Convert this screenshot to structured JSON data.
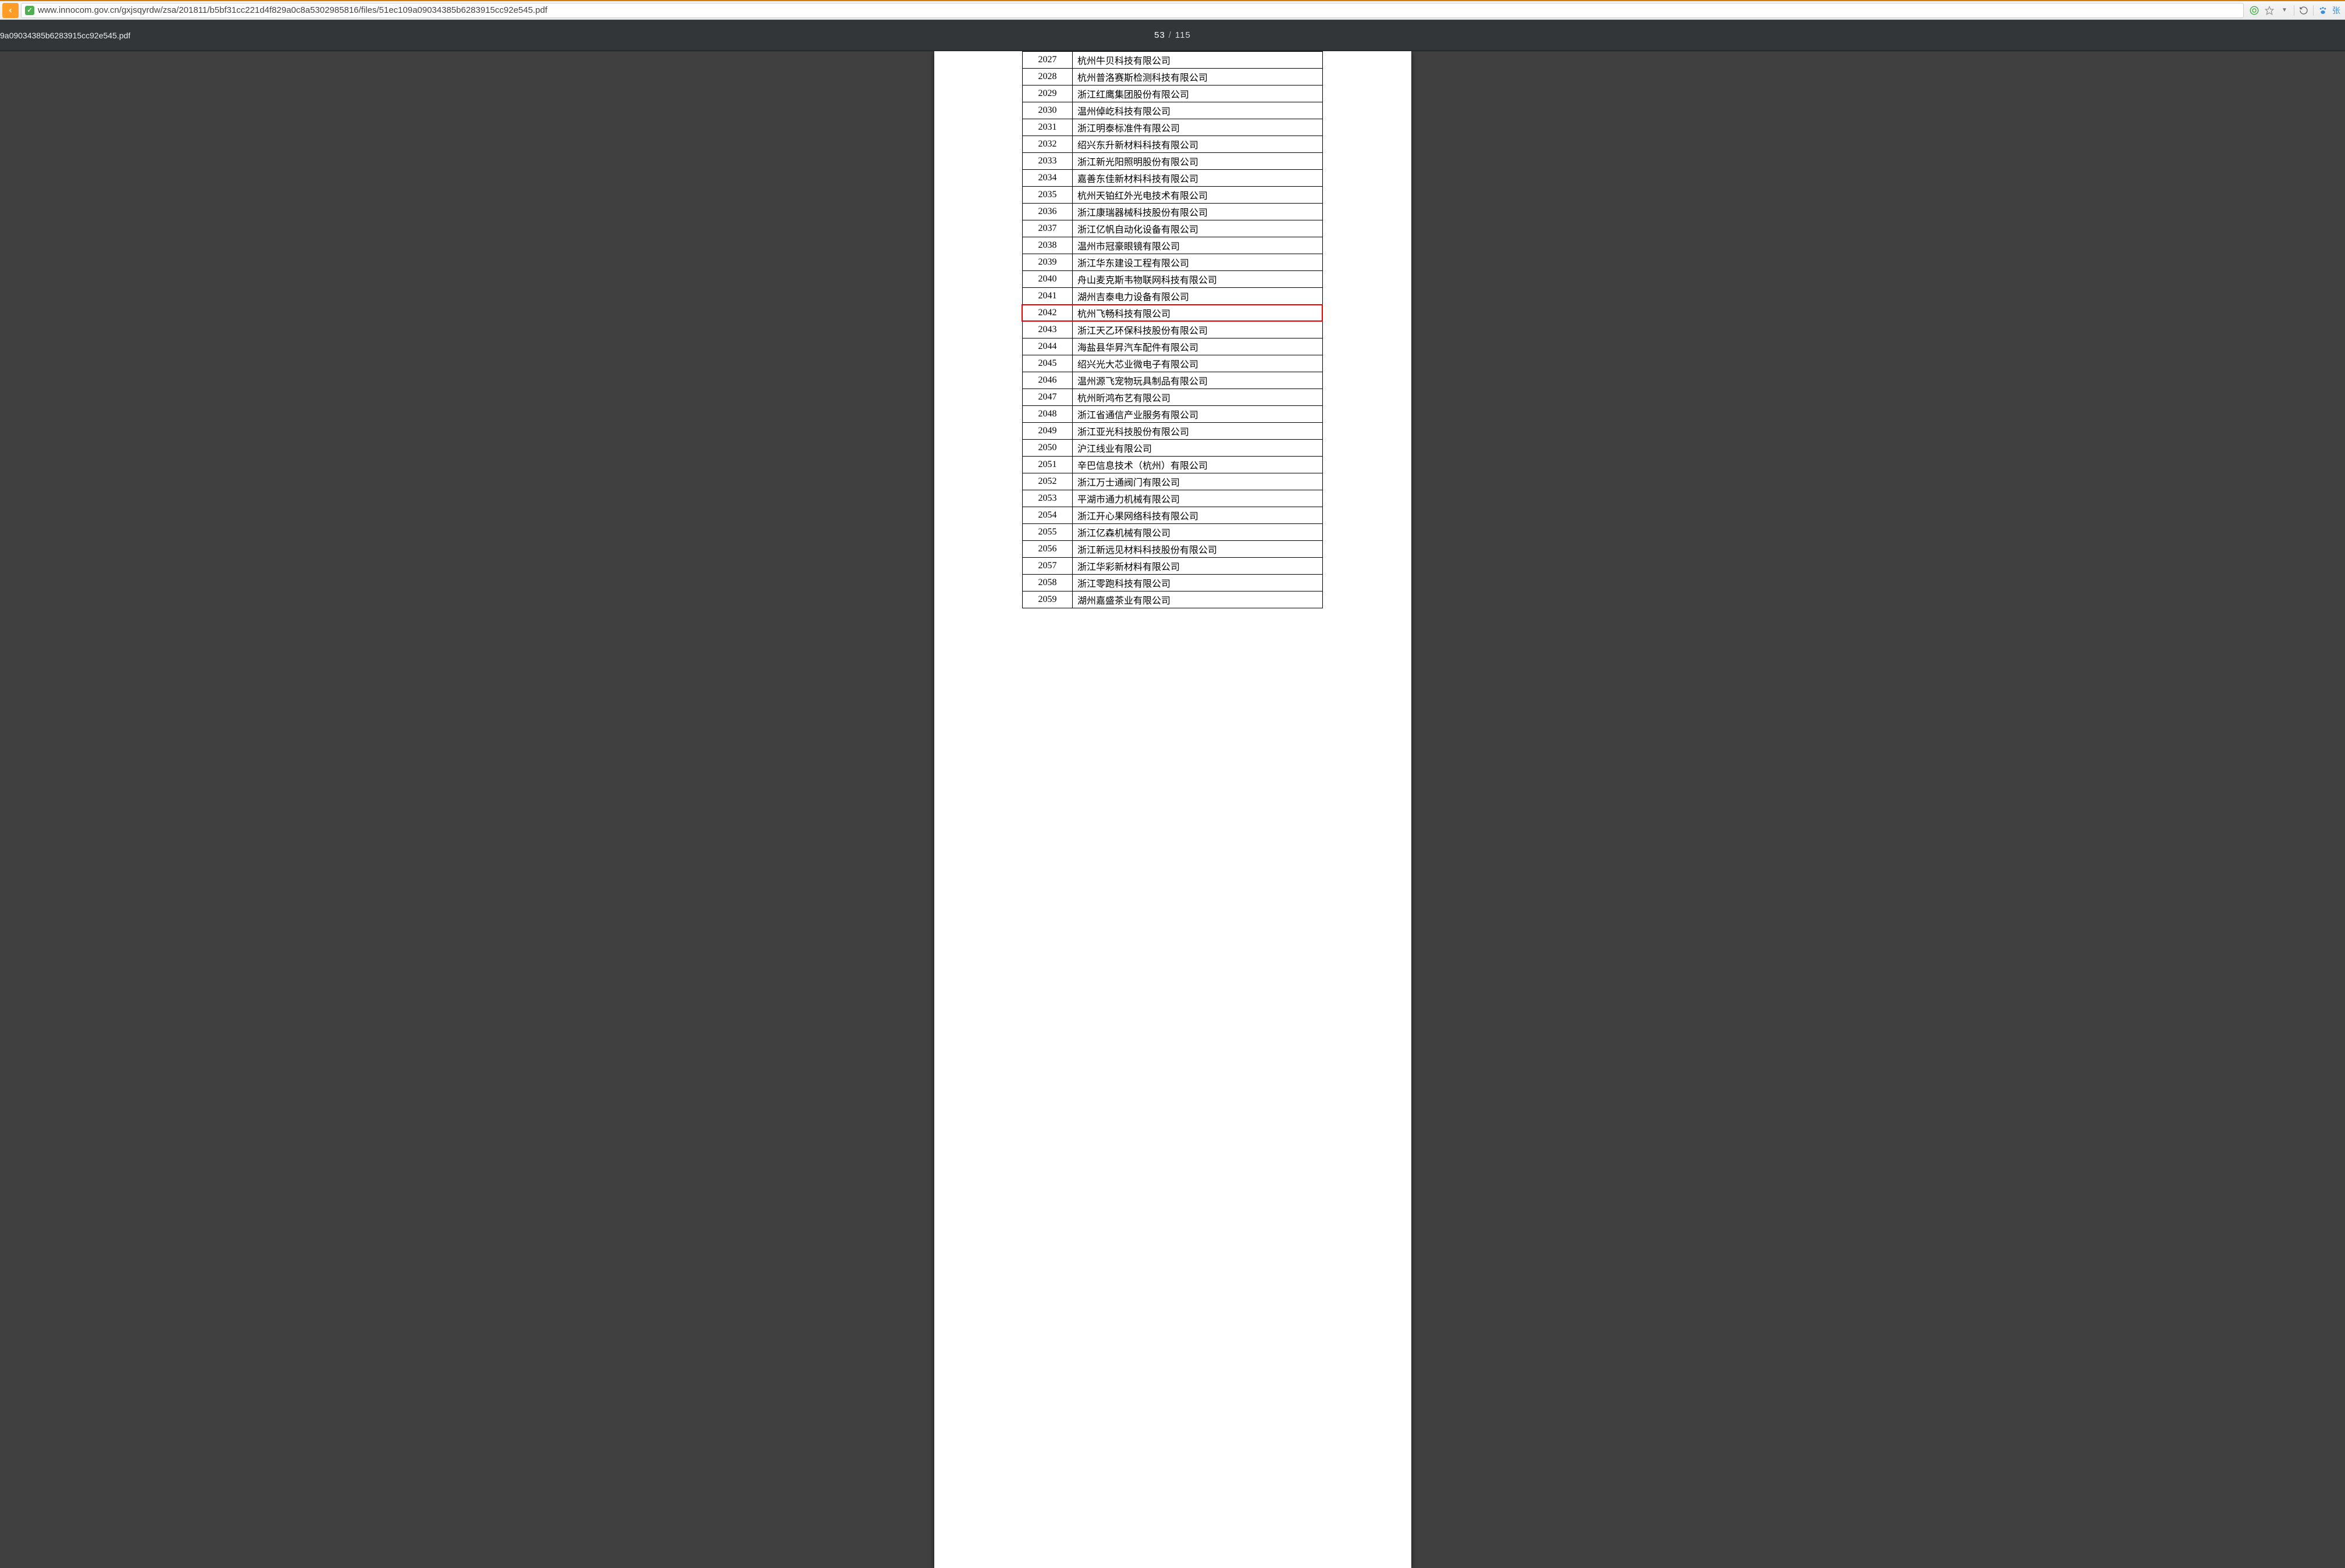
{
  "browser": {
    "url": "www.innocom.gov.cn/gxjsqyrdw/zsa/201811/b5bf31cc221d4f829a0c8a5302985816/files/51ec109a09034385b6283915cc92e545.pdf",
    "user_label": "张",
    "secure_icon": "✓"
  },
  "pdf": {
    "title_fragment": "9a09034385b6283915cc92e545.pdf",
    "current_page": "53",
    "total_pages": "115"
  },
  "highlight_row_id": "2042",
  "rows": [
    {
      "id": "2027",
      "name": "杭州牛贝科技有限公司"
    },
    {
      "id": "2028",
      "name": "杭州普洛赛斯检测科技有限公司"
    },
    {
      "id": "2029",
      "name": "浙江红鹰集团股份有限公司"
    },
    {
      "id": "2030",
      "name": "温州倬屹科技有限公司"
    },
    {
      "id": "2031",
      "name": "浙江明泰标准件有限公司"
    },
    {
      "id": "2032",
      "name": "绍兴东升新材料科技有限公司"
    },
    {
      "id": "2033",
      "name": "浙江新光阳照明股份有限公司"
    },
    {
      "id": "2034",
      "name": "嘉善东佳新材料科技有限公司"
    },
    {
      "id": "2035",
      "name": "杭州天铂红外光电技术有限公司"
    },
    {
      "id": "2036",
      "name": "浙江康瑞器械科技股份有限公司"
    },
    {
      "id": "2037",
      "name": "浙江亿帆自动化设备有限公司"
    },
    {
      "id": "2038",
      "name": "温州市冠豪眼镜有限公司"
    },
    {
      "id": "2039",
      "name": "浙江华东建设工程有限公司"
    },
    {
      "id": "2040",
      "name": "舟山麦克斯韦物联网科技有限公司"
    },
    {
      "id": "2041",
      "name": "湖州吉泰电力设备有限公司"
    },
    {
      "id": "2042",
      "name": "杭州飞畅科技有限公司"
    },
    {
      "id": "2043",
      "name": "浙江天乙环保科技股份有限公司"
    },
    {
      "id": "2044",
      "name": "海盐县华昇汽车配件有限公司"
    },
    {
      "id": "2045",
      "name": "绍兴光大芯业微电子有限公司"
    },
    {
      "id": "2046",
      "name": "温州源飞宠物玩具制品有限公司"
    },
    {
      "id": "2047",
      "name": "杭州昕鸿布艺有限公司"
    },
    {
      "id": "2048",
      "name": "浙江省通信产业服务有限公司"
    },
    {
      "id": "2049",
      "name": "浙江亚光科技股份有限公司"
    },
    {
      "id": "2050",
      "name": "沪江线业有限公司"
    },
    {
      "id": "2051",
      "name": "辛巴信息技术（杭州）有限公司"
    },
    {
      "id": "2052",
      "name": "浙江万士通阀门有限公司"
    },
    {
      "id": "2053",
      "name": "平湖市通力机械有限公司"
    },
    {
      "id": "2054",
      "name": "浙江开心果网络科技有限公司"
    },
    {
      "id": "2055",
      "name": "浙江亿森机械有限公司"
    },
    {
      "id": "2056",
      "name": "浙江新远见材料科技股份有限公司"
    },
    {
      "id": "2057",
      "name": "浙江华彩新材料有限公司"
    },
    {
      "id": "2058",
      "name": "浙江零跑科技有限公司"
    },
    {
      "id": "2059",
      "name": "湖州嘉盛茶业有限公司"
    }
  ]
}
